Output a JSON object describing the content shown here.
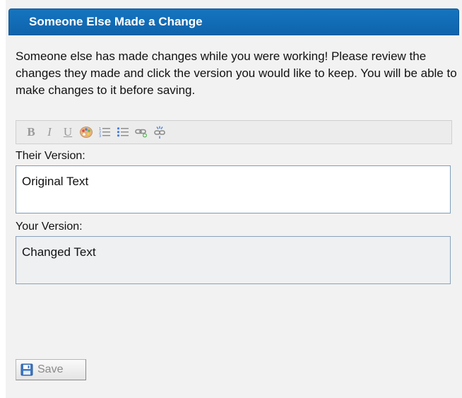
{
  "dialog": {
    "title": "Someone Else Made a Change",
    "message": "Someone else has made changes while you were working! Please review the changes they made and click the version you would like to keep. You will be able to make changes to it before saving."
  },
  "toolbar": {
    "buttons": [
      {
        "name": "bold",
        "glyph": "B"
      },
      {
        "name": "italic",
        "glyph": "I"
      },
      {
        "name": "underline",
        "glyph": "U"
      },
      {
        "name": "color-palette-icon"
      },
      {
        "name": "ordered-list-icon"
      },
      {
        "name": "unordered-list-icon"
      },
      {
        "name": "link-icon"
      },
      {
        "name": "unlink-icon"
      }
    ]
  },
  "their_version": {
    "label": "Their Version:",
    "value": "Original Text"
  },
  "your_version": {
    "label": "Your Version:",
    "value": "Changed Text"
  },
  "save": {
    "label": "Save",
    "icon": "floppy-disk-icon"
  },
  "colors": {
    "title_bar": "#1170b8",
    "panel_bg": "#f2f2f2",
    "field_border": "#7f9db9"
  }
}
